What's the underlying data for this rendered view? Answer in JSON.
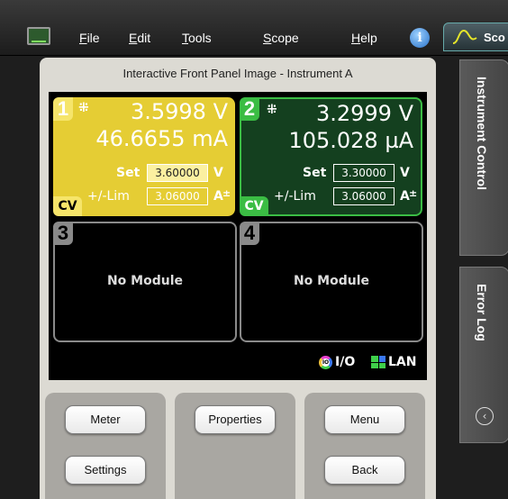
{
  "menubar": {
    "items": [
      "File",
      "Edit",
      "Tools",
      "Scope",
      "Help"
    ],
    "scope_tab": "Sco"
  },
  "panel": {
    "title": "Interactive Front Panel Image - Instrument A"
  },
  "channels": [
    {
      "number": "1",
      "voltage": "3.5998 V",
      "current": "46.6655 mA",
      "set_label": "Set",
      "set_value": "3.60000",
      "set_unit": "V",
      "lim_label": "+/-Lim",
      "lim_value": "3.06000",
      "lim_unit": "A",
      "mode": "CV",
      "color": "#e5cd34"
    },
    {
      "number": "2",
      "voltage": "3.2999 V",
      "current": "105.028 µA",
      "set_label": "Set",
      "set_value": "3.30000",
      "set_unit": "V",
      "lim_label": "+/-Lim",
      "lim_value": "3.06000",
      "lim_unit": "A",
      "mode": "CV",
      "color": "#3bbd44"
    },
    {
      "number": "3",
      "status": "No Module"
    },
    {
      "number": "4",
      "status": "No Module"
    }
  ],
  "status": {
    "io": "I/O",
    "io_icon_text": "IO",
    "lan": "LAN"
  },
  "buttons": {
    "meter": "Meter",
    "settings": "Settings",
    "properties": "Properties",
    "menu": "Menu",
    "back": "Back"
  },
  "sidebar": {
    "instrument_control": "Instrument Control",
    "error_log": "Error Log"
  }
}
